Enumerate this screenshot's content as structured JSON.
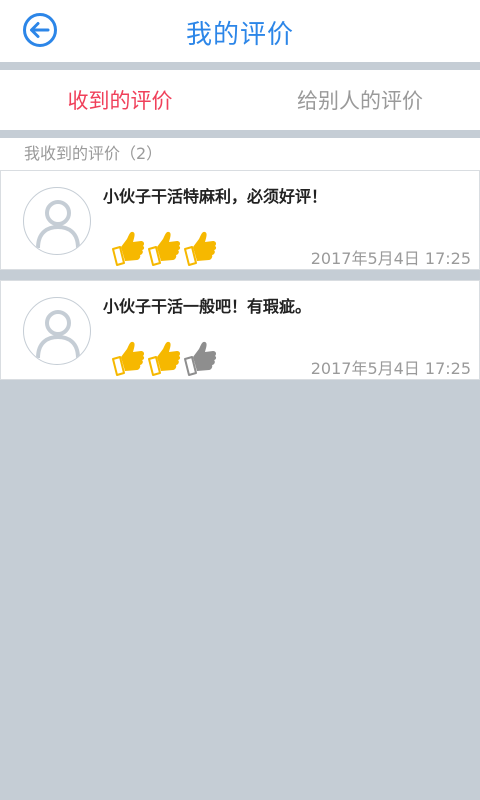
{
  "header": {
    "title": "我的评价"
  },
  "tabs": [
    {
      "label": "收到的评价",
      "active": true
    },
    {
      "label": "给别人的评价",
      "active": false
    }
  ],
  "section": {
    "title": "我收到的评价（2）"
  },
  "reviews": [
    {
      "text": "小伙子干活特麻利，必须好评！",
      "rating": 3,
      "max_rating": 3,
      "time": "2017年5月4日 17:25"
    },
    {
      "text": "小伙子干活一般吧！有瑕疵。",
      "rating": 2,
      "max_rating": 3,
      "time": "2017年5月4日 17:25"
    }
  ],
  "colors": {
    "accent": "#2c86e8",
    "active_tab": "#f0405a",
    "thumb_on": "#f6b800",
    "thumb_off": "#8e8e8e",
    "background": "#c5cdd5"
  },
  "icons": {
    "back": "arrow-left-circle-icon",
    "avatar": "user-avatar-icon",
    "rating": "thumbs-up-icon"
  }
}
